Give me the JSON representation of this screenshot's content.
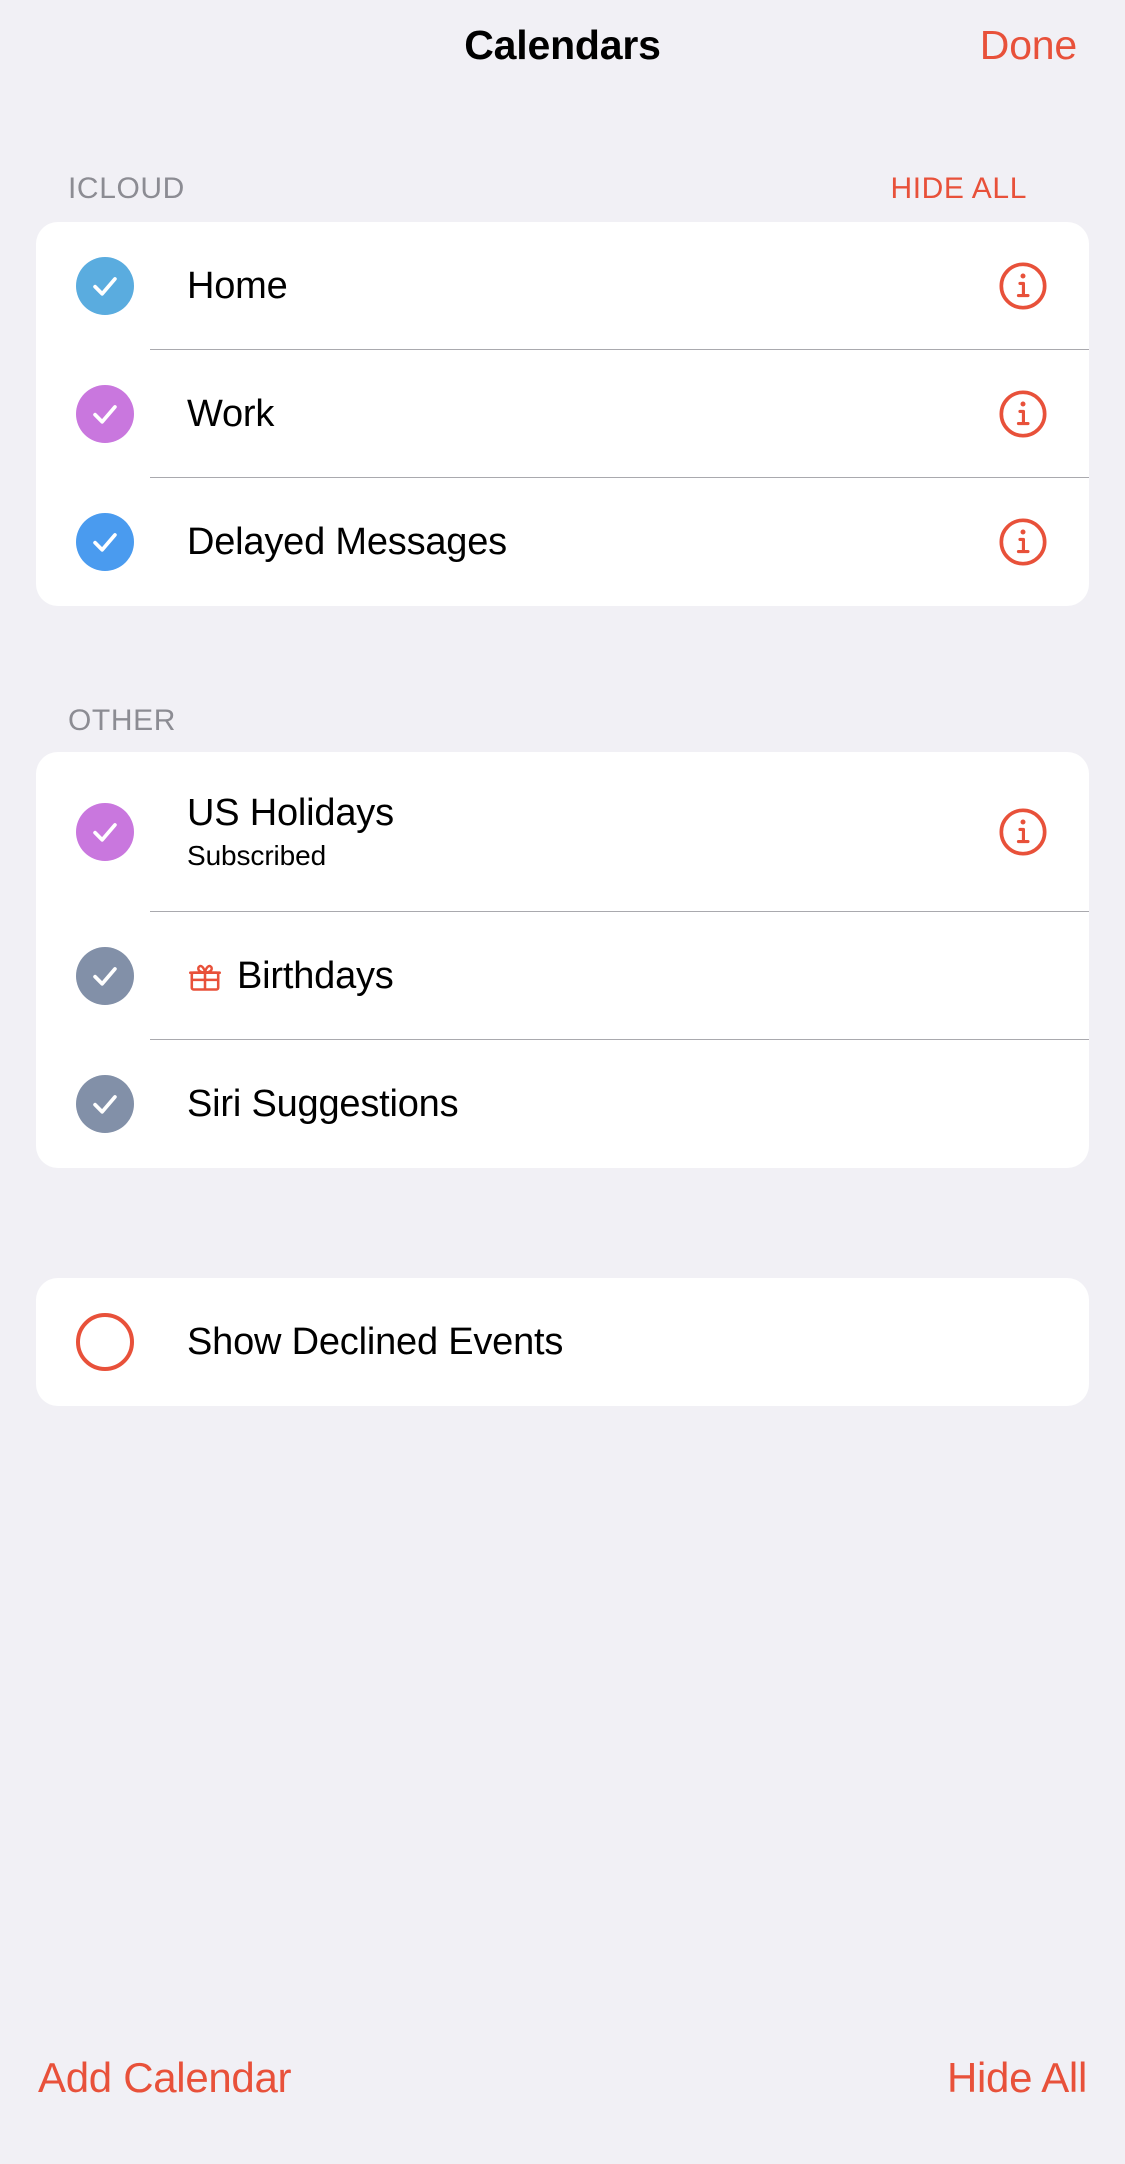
{
  "navbar": {
    "title": "Calendars",
    "done_label": "Done"
  },
  "colors": {
    "accent_red": "#E8513A",
    "background": "#F1F0F5",
    "card": "#FFFFFF",
    "section_label": "#8C8C93",
    "divider": "#A9A9AE",
    "home_blue": "#5AACDF",
    "work_purple": "#C977DE",
    "delayed_blue": "#4A9BEF",
    "holidays_purple": "#C977DE",
    "gray_blue": "#8290A8"
  },
  "sections": [
    {
      "header": "ICLOUD",
      "action": "HIDE ALL",
      "rows": [
        {
          "name": "Home",
          "subtitle": "",
          "color": "#5AACDF",
          "checked": true,
          "has_info": true,
          "icon": ""
        },
        {
          "name": "Work",
          "subtitle": "",
          "color": "#C977DE",
          "checked": true,
          "has_info": true,
          "icon": ""
        },
        {
          "name": "Delayed Messages",
          "subtitle": "",
          "color": "#4A9BEF",
          "checked": true,
          "has_info": true,
          "icon": ""
        }
      ]
    },
    {
      "header": "OTHER",
      "action": "",
      "rows": [
        {
          "name": "US Holidays",
          "subtitle": "Subscribed",
          "color": "#C977DE",
          "checked": true,
          "has_info": true,
          "icon": ""
        },
        {
          "name": "Birthdays",
          "subtitle": "",
          "color": "#8290A8",
          "checked": true,
          "has_info": false,
          "icon": "gift-icon"
        },
        {
          "name": "Siri Suggestions",
          "subtitle": "",
          "color": "#8290A8",
          "checked": true,
          "has_info": false,
          "icon": ""
        }
      ]
    }
  ],
  "declined": {
    "label": "Show Declined Events",
    "checked": false,
    "circle_color": "#E8513A"
  },
  "toolbar": {
    "add_calendar_label": "Add Calendar",
    "hide_all_label": "Hide All"
  }
}
